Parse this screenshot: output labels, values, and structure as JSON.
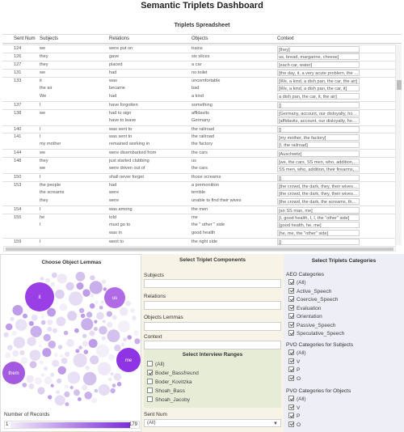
{
  "dashboard_title": "Semantic Triplets Dashboard",
  "spreadsheet": {
    "title": "Triplets Spreadsheet",
    "columns": [
      "Sent Num",
      "Subjects",
      "Relations",
      "Objects",
      "Context"
    ],
    "rows": [
      [
        "124",
        "we",
        "were put on",
        "trains",
        "[they]"
      ],
      [
        "126",
        "they",
        "gave",
        "six slices",
        "us, bread, margarine, cheese]"
      ],
      [
        "127",
        "they",
        "placed",
        "a car",
        "[each car, water]"
      ],
      [
        "131",
        "we",
        "had",
        "no toilet",
        "[the day, it, a very acute problem, the excite..."
      ],
      [
        "133",
        "it",
        "was",
        "uncomfortable",
        "[We, a kind, a dish pan, the car, the air]"
      ],
      [
        "",
        "the air",
        "became",
        "bad",
        "[We, a kind, a dish pan, the car, it]"
      ],
      [
        "",
        "We",
        "had",
        "a kind",
        "a dish pan, the car, it, the air]"
      ],
      [
        "137",
        "I",
        "have forgotten",
        "something",
        "[]"
      ],
      [
        "138",
        "we",
        "had to sign",
        "affidavits",
        "[Germany, account, our disloyalty, hostility..."
      ],
      [
        "",
        "",
        "have to leave",
        "Germany",
        "[affidavits, account, our disloyalty, hostility]"
      ],
      [
        "140",
        "I",
        "was sent to",
        "the railroad",
        "[]"
      ],
      [
        "141",
        "I",
        "was sent to",
        "the railroad",
        "[my mother, the factory]"
      ],
      [
        "",
        "my mother",
        "remained working in",
        "the factory",
        "[I, the railroad]"
      ],
      [
        "144",
        "we",
        "were disembarked from",
        "the cars",
        "[Auschwitz]"
      ],
      [
        "148",
        "they",
        "just started clubbing",
        "us",
        "[we, the cars, SS men, who, addition, their f..."
      ],
      [
        "",
        "we",
        "were driven out of",
        "the cars",
        "SS men, who, addition, their firearms, walk..."
      ],
      [
        "150",
        "I",
        "shall never forget",
        "those screams",
        "[]"
      ],
      [
        "153",
        "the people",
        "had",
        "a premonition",
        "[the crowd, the dark, they, their wives, the..."
      ],
      [
        "",
        "the screams",
        "were",
        "terrible",
        "[the crowd, the dark, they, their wives, the..."
      ],
      [
        "",
        "they",
        "were",
        "unable to find their wives",
        "[the crowd, the dark, the screams, the peop..."
      ],
      [
        "154",
        "I",
        "was among",
        "the men",
        "[an SS man, me]"
      ],
      [
        "155",
        "he",
        "told",
        "me",
        "[I, good health, I, I, the \"other\" side]"
      ],
      [
        "",
        "I",
        "must go to",
        "the \" other \" side",
        "[good health, he, me]"
      ],
      [
        "",
        "",
        "was in",
        "good health",
        "[he, me, the \"other\" side]"
      ],
      [
        "159",
        "I",
        "went to",
        "the right side",
        "[]"
      ]
    ],
    "first_in_group": [
      true,
      true,
      true,
      true,
      true,
      false,
      false,
      true,
      true,
      false,
      true,
      true,
      false,
      true,
      true,
      false,
      true,
      true,
      false,
      false,
      true,
      true,
      false,
      false,
      true
    ]
  },
  "lemmas_panel": {
    "title": "Choose Object Lemmas",
    "bubble_labels": [
      "it",
      "us",
      "me",
      "them"
    ],
    "records_label": "Number of Records",
    "legend_min": "1",
    "legend_max": "179",
    "accent_color": "#7a2cd9"
  },
  "components_panel": {
    "title": "Select Triplet Components",
    "subjects_label": "Subjects",
    "relations_label": "Relations",
    "objects_lemmas_label": "Objects Lemmas",
    "context_label": "Context",
    "ranges_title": "Select Interview Ranges",
    "ranges": [
      {
        "label": "(All)",
        "checked": false
      },
      {
        "label": "Boder_Bassfreund",
        "checked": true
      },
      {
        "label": "Boder_Kovitzka",
        "checked": false
      },
      {
        "label": "Shoah_Bass",
        "checked": false
      },
      {
        "label": "Shoah_Jacoby",
        "checked": false
      }
    ],
    "sent_num_label": "Sent Num",
    "sent_num_value": "(All)"
  },
  "categories_panel": {
    "title": "Select Triplets Categories",
    "aeo_title": "AEO Categories",
    "aeo": [
      "(All)",
      "Active_Speech",
      "Coercive_Speech",
      "Evaluation",
      "Orientation",
      "Passive_Speech",
      "Speculative_Speech"
    ],
    "pvo_subjects_title": "PVO Categories for Subjects",
    "pvo_subjects": [
      "(All)",
      "V",
      "P",
      "O"
    ],
    "pvo_objects_title": "PVO Categories for Objects",
    "pvo_objects": [
      "(All)",
      "V",
      "P",
      "O"
    ]
  }
}
